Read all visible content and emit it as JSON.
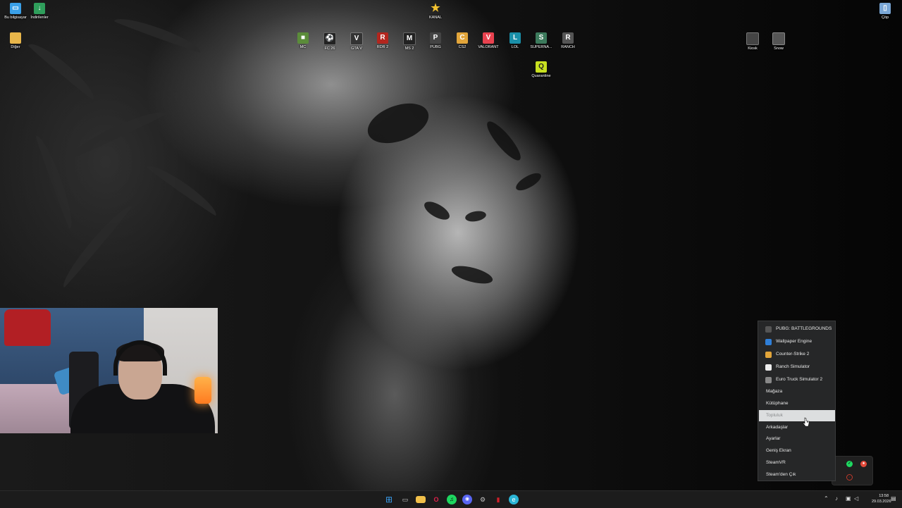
{
  "desktop": {
    "top_left_icons": [
      {
        "label": "Bu bilgisayar",
        "icon": "computer-icon",
        "color": "#3aa0e8"
      },
      {
        "label": "İndirilenler",
        "icon": "download-folder-icon",
        "color": "#2f9e5b"
      },
      {
        "label": "Diğer",
        "icon": "folder-icon",
        "color": "#e8b64a"
      }
    ],
    "top_center_icon": {
      "label": "KANAL",
      "icon": "star-icon",
      "color": "#f2c230"
    },
    "game_icons": [
      {
        "label": "MC",
        "icon": "minecraft-icon",
        "color": "#5b8c3a"
      },
      {
        "label": "FC 26",
        "icon": "fc26-icon",
        "color": "#222222"
      },
      {
        "label": "GTA V",
        "icon": "gta-icon",
        "color": "#333333"
      },
      {
        "label": "RDR 2",
        "icon": "rdr2-icon",
        "color": "#b3261e"
      },
      {
        "label": "MS 2",
        "icon": "ms2-icon",
        "color": "#222222"
      },
      {
        "label": "PUBG",
        "icon": "pubg-icon",
        "color": "#444444"
      },
      {
        "label": "CS2",
        "icon": "cs2-icon",
        "color": "#e2a53a"
      },
      {
        "label": "VALORANT",
        "icon": "valorant-icon",
        "color": "#e8424f"
      },
      {
        "label": "LOL",
        "icon": "lol-icon",
        "color": "#1a8fa8"
      },
      {
        "label": "SUPERNA...",
        "icon": "supernatural-icon",
        "color": "#3c7a5c"
      },
      {
        "label": "RANCH",
        "icon": "ranch-icon",
        "color": "#555555"
      }
    ],
    "second_row_icon": {
      "label": "Quarantine",
      "icon": "quarantine-icon",
      "color": "#c8e020"
    },
    "right_icons": [
      {
        "label": "Kiosk",
        "icon": "kiosk-icon",
        "color": "#444444"
      },
      {
        "label": "Snow",
        "icon": "snow-icon",
        "color": "#555555"
      }
    ],
    "recycle_bin": {
      "label": "Çöp",
      "icon": "recycle-bin-icon",
      "color": "#7aa7d6"
    }
  },
  "steam_menu": {
    "recent_games": [
      {
        "label": "PUBG: BATTLEGROUNDS",
        "icon": "pubg-icon",
        "color": "#555555"
      },
      {
        "label": "Wallpaper Engine",
        "icon": "wallpaper-engine-icon",
        "color": "#2f7fd8"
      },
      {
        "label": "Counter-Strike 2",
        "icon": "cs2-icon",
        "color": "#e2a53a"
      },
      {
        "label": "Ranch Simulator",
        "icon": "ranch-icon",
        "color": "#eeeeee"
      },
      {
        "label": "Euro Truck Simulator 2",
        "icon": "ets2-icon",
        "color": "#888888"
      }
    ],
    "items": [
      {
        "label": "Mağaza"
      },
      {
        "label": "Kütüphane"
      },
      {
        "label": "Topluluk",
        "hovered": true
      },
      {
        "label": "Arkadaşlar"
      },
      {
        "label": "Ayarlar"
      },
      {
        "label": "Geniş Ekran"
      },
      {
        "label": "SteamVR"
      },
      {
        "label": "Steam'den Çık"
      }
    ]
  },
  "taskbar": {
    "apps": [
      {
        "name": "start-button",
        "glyph": "⊞",
        "color": "#3a9ff0"
      },
      {
        "name": "task-view",
        "glyph": "▭",
        "color": "#cfcfcf"
      },
      {
        "name": "file-explorer",
        "glyph": "▬",
        "color": "#f1c04a"
      },
      {
        "name": "opera-gx",
        "glyph": "O",
        "color": "#e0214b"
      },
      {
        "name": "spotify",
        "glyph": "♫",
        "color": "#1ed760"
      },
      {
        "name": "discord",
        "glyph": "◉",
        "color": "#5865f2"
      },
      {
        "name": "steam",
        "glyph": "⚙",
        "color": "#c0c0c0"
      },
      {
        "name": "app-red",
        "glyph": "▮",
        "color": "#d0202a"
      },
      {
        "name": "edge",
        "glyph": "e",
        "color": "#2bb5d6"
      }
    ],
    "clock": {
      "time": "13:58",
      "date": "29.03.2026"
    }
  }
}
